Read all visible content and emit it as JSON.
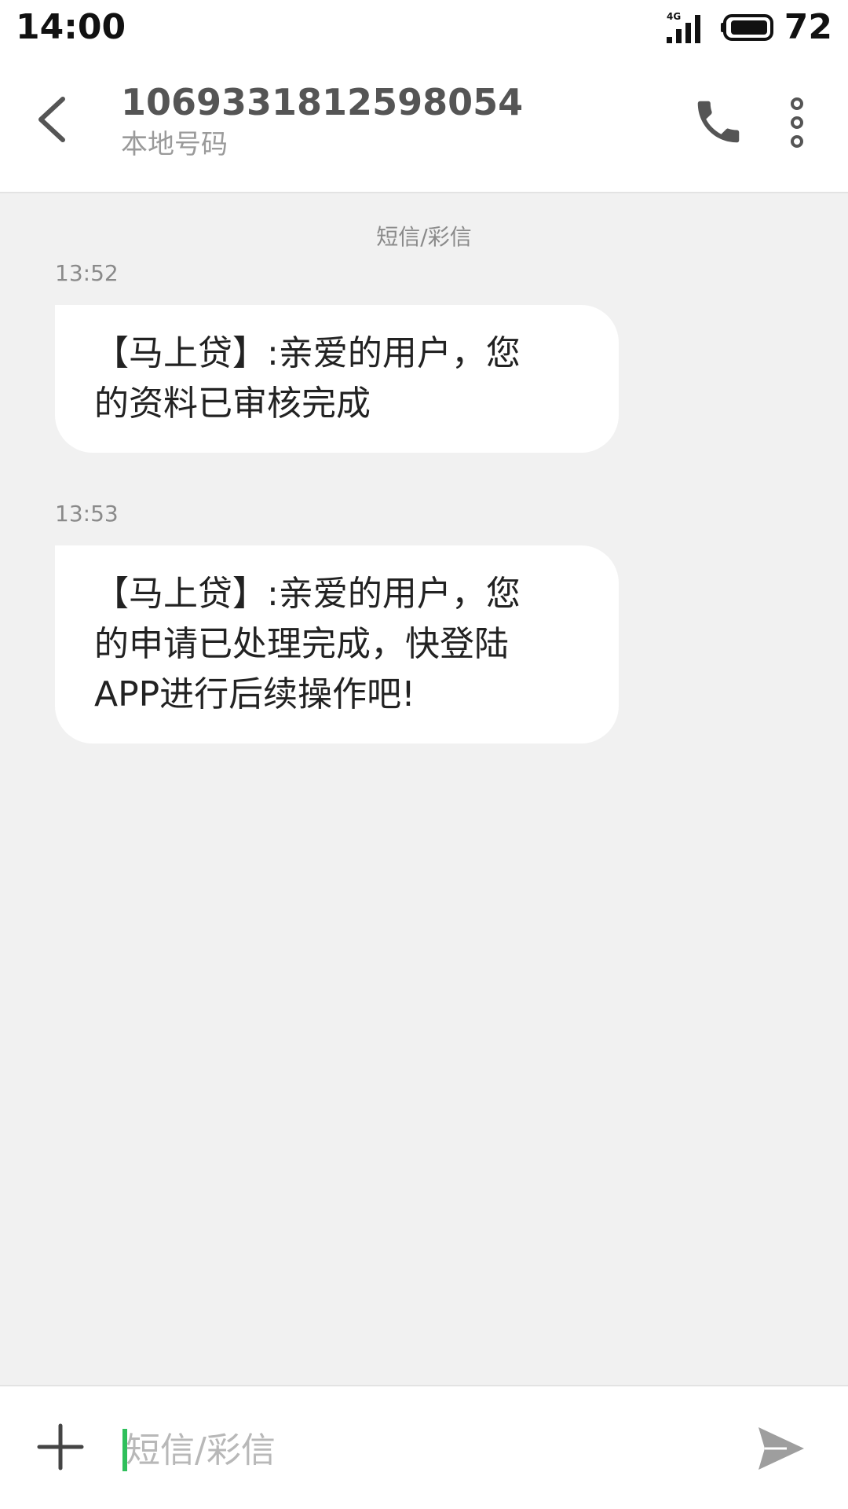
{
  "status_bar": {
    "time": "14:00",
    "network": "4G",
    "battery": "72"
  },
  "header": {
    "contact_number": "1069331812598054",
    "contact_sub": "本地号码",
    "icons": {
      "back": "chevron-left-icon",
      "call": "phone-icon",
      "more": "more-vertical-icon"
    }
  },
  "conversation": {
    "channel_label": "短信/彩信",
    "messages": [
      {
        "time": "13:52",
        "text_line1": "【马上贷】:亲爱的用户，您",
        "text_line2": "的资料已审核完成"
      },
      {
        "time": "13:53",
        "text_line1": "【马上贷】:亲爱的用户，您",
        "text_line2": "的申请已处理完成，快登陆",
        "text_line3": "APP进行后续操作吧!"
      }
    ]
  },
  "composer": {
    "placeholder": "短信/彩信",
    "icons": {
      "add": "plus-icon",
      "send": "send-icon"
    },
    "colors": {
      "caret": "#2fbf5b"
    }
  }
}
